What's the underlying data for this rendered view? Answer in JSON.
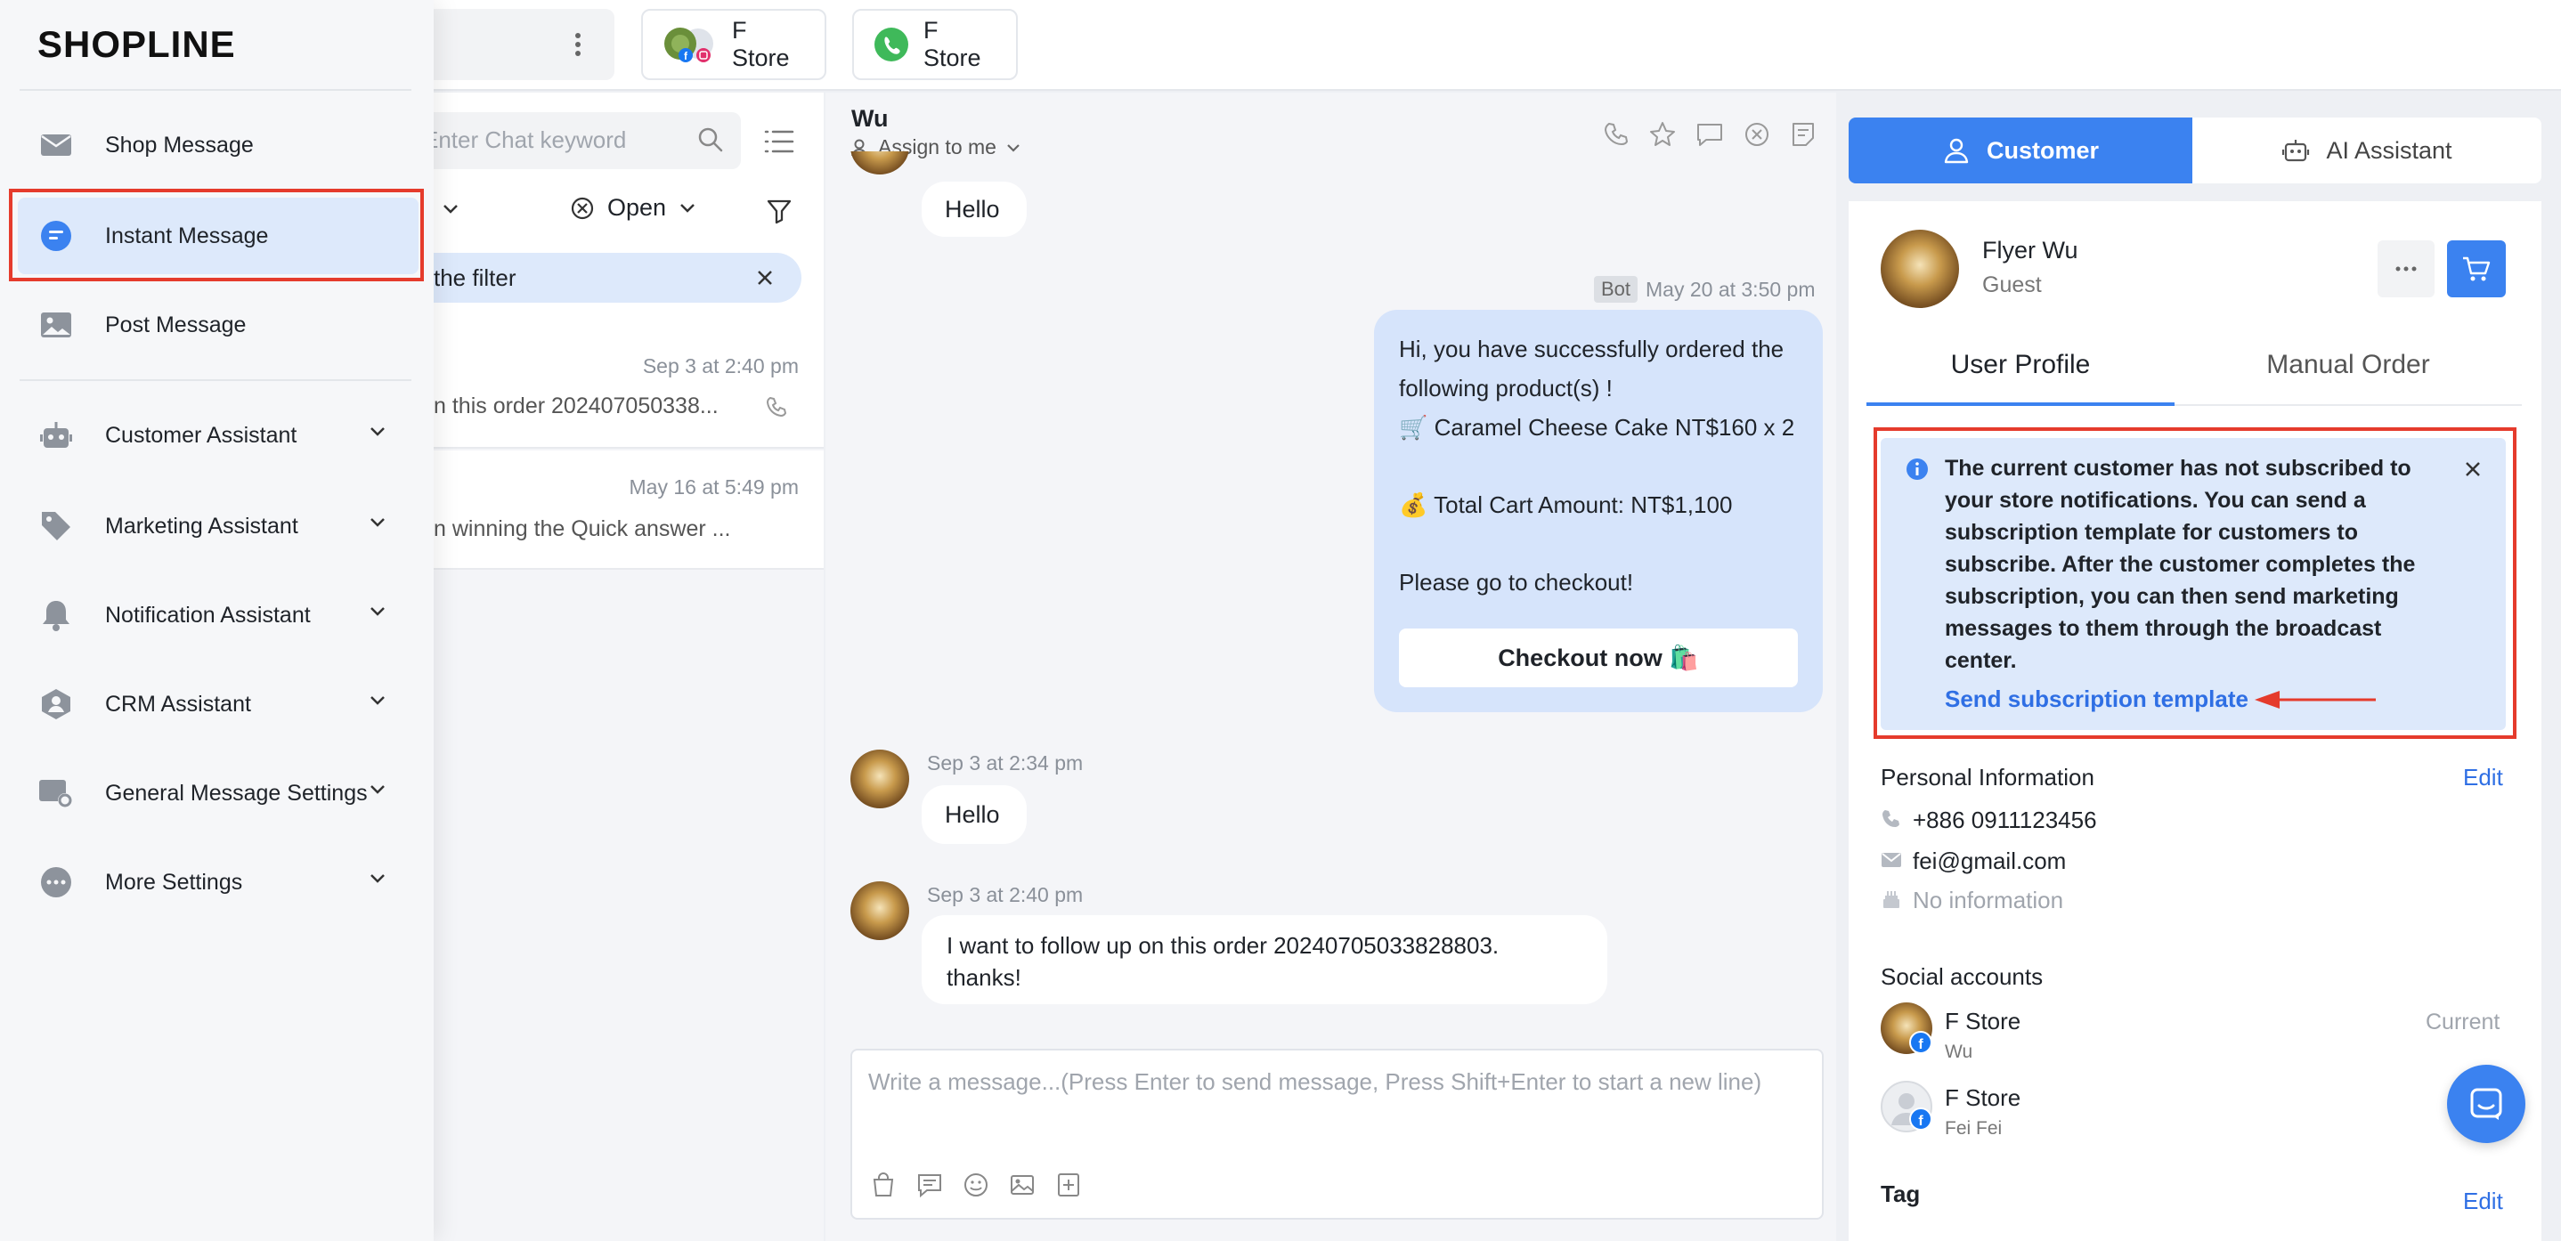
{
  "brand": {
    "logo_text": "SHOPLINE"
  },
  "header": {
    "store_tabs": [
      {
        "label": "F Store"
      },
      {
        "label": "F Store"
      }
    ]
  },
  "conversations": {
    "search_placeholder": "Enter Chat keyword",
    "status_filter": "Open",
    "filter_chip_text": "the filter",
    "items": [
      {
        "time": "Sep 3 at 2:40 pm",
        "preview": "n this order 202407050338..."
      },
      {
        "time": "May 16 at 5:49 pm",
        "preview": "n winning the Quick answer  ..."
      }
    ]
  },
  "chat": {
    "contact_name": "Wu",
    "assign_label": "Assign to me",
    "messages": [
      {
        "text": "Hello"
      },
      {
        "bot_badge": "Bot",
        "time": "May 20 at 3:50 pm",
        "line1": "Hi, you have successfully ordered the",
        "line2": "following product(s) !",
        "line3": "🛒 Caramel Cheese Cake NT$160 x 2",
        "line4": "💰 Total Cart Amount: NT$1,100",
        "line5": "Please go to checkout!",
        "button": "Checkout now 🛍️"
      },
      {
        "time": "Sep 3 at 2:34 pm",
        "text": "Hello"
      },
      {
        "time": "Sep 3 at 2:40 pm",
        "line1": "I want to follow up on this order 20240705033828803.",
        "line2": "thanks!"
      }
    ],
    "composer_placeholder": "Write a message...(Press Enter to send message, Press Shift+Enter to start a new line)"
  },
  "right_panel": {
    "tabs": {
      "customer": "Customer",
      "ai": "AI Assistant"
    },
    "customer": {
      "name": "Flyer Wu",
      "type": "Guest"
    },
    "subtabs": {
      "profile": "User Profile",
      "order": "Manual Order"
    },
    "notice": {
      "lines": [
        "The current customer has not subscribed to",
        "your store notifications. You can send a",
        "subscription template for customers to",
        "subscribe. After the customer completes the",
        "subscription, you can then send marketing",
        "messages to them through the broadcast",
        "center."
      ],
      "link": "Send subscription template"
    },
    "personal": {
      "title": "Personal Information",
      "edit": "Edit",
      "phone": "+886 0911123456",
      "email": "fei@gmail.com",
      "birthday": "No information"
    },
    "social": {
      "title": "Social accounts",
      "accounts": [
        {
          "store": "F Store",
          "user": "Wu",
          "status": "Current"
        },
        {
          "store": "F Store",
          "user": "Fei Fei",
          "status": ""
        }
      ]
    },
    "tag": {
      "title": "Tag",
      "edit": "Edit"
    }
  },
  "sidebar": {
    "items": [
      {
        "label": "Shop Message"
      },
      {
        "label": "Instant Message"
      },
      {
        "label": "Post Message"
      },
      {
        "label": "Customer Assistant"
      },
      {
        "label": "Marketing Assistant"
      },
      {
        "label": "Notification Assistant"
      },
      {
        "label": "CRM Assistant"
      },
      {
        "label": "General Message Settings"
      },
      {
        "label": "More Settings"
      }
    ]
  },
  "colors": {
    "primary": "#3b82f0",
    "highlight": "#e53b2c",
    "active_bg": "#dde9fb"
  }
}
